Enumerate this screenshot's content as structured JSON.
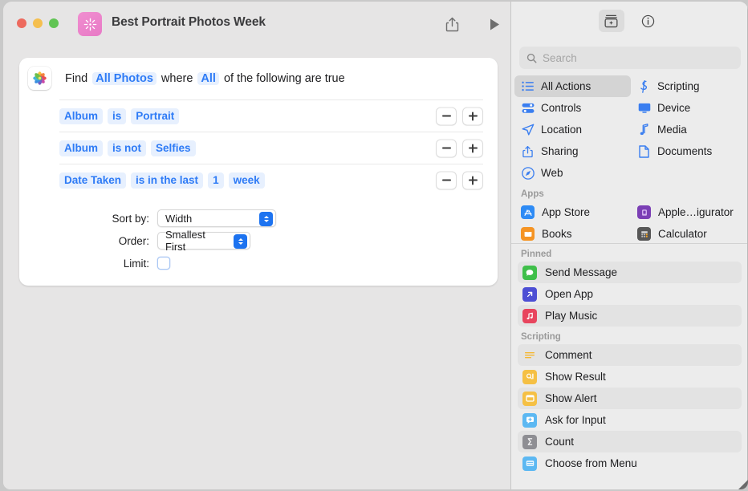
{
  "window": {
    "title": "Best Portrait Photos Week",
    "app_icon": "shortcuts-icon",
    "traffic_lights": [
      "close",
      "minimize",
      "zoom"
    ],
    "share_button": "share-icon",
    "run_button": "play-icon",
    "accent_color": "#2e7bf6",
    "background_color": "#e6e5e5"
  },
  "action_card": {
    "source_icon": "photos-icon",
    "header": {
      "find_label": "Find",
      "source_token": "All Photos",
      "where_label": "where",
      "match_token": "All",
      "suffix_label": "of the following are true"
    },
    "filters": [
      {
        "field": "Album",
        "operator": "is",
        "value": "Portrait",
        "extra": "",
        "unit": "",
        "remove_label": "−",
        "add_label": "+"
      },
      {
        "field": "Album",
        "operator": "is not",
        "value": "Selfies",
        "extra": "",
        "unit": "",
        "remove_label": "−",
        "add_label": "+"
      },
      {
        "field": "Date Taken",
        "operator": "is in the last",
        "value": "1",
        "extra": "week",
        "unit": "",
        "remove_label": "−",
        "add_label": "+"
      }
    ],
    "options": {
      "sort_by_label": "Sort by:",
      "sort_by_value": "Width",
      "order_label": "Order:",
      "order_value": "Smallest First",
      "limit_label": "Limit:",
      "limit_checked": false
    }
  },
  "library": {
    "toolbar": [
      {
        "name": "action-library-button",
        "icon": "library-icon",
        "selected": true
      },
      {
        "name": "info-button",
        "icon": "info-circle-icon",
        "selected": false
      }
    ],
    "search": {
      "placeholder": "Search",
      "value": "",
      "icon": "search-icon"
    },
    "categories": [
      {
        "label": "All Actions",
        "icon": "list-icon",
        "selected": true
      },
      {
        "label": "Scripting",
        "icon": "scripting-icon",
        "selected": false
      },
      {
        "label": "Controls",
        "icon": "controls-icon",
        "selected": false
      },
      {
        "label": "Device",
        "icon": "device-icon",
        "selected": false
      },
      {
        "label": "Location",
        "icon": "location-icon",
        "selected": false
      },
      {
        "label": "Media",
        "icon": "media-note-icon",
        "selected": false
      },
      {
        "label": "Sharing",
        "icon": "share-icon",
        "selected": false
      },
      {
        "label": "Documents",
        "icon": "document-icon",
        "selected": false
      },
      {
        "label": "Web",
        "icon": "web-compass-icon",
        "selected": false
      }
    ],
    "apps_section": {
      "header": "Apps",
      "items": [
        {
          "label": "App Store",
          "icon": "app-store-icon",
          "color": "#2e8bf5"
        },
        {
          "label": "Apple…igurator",
          "icon": "apple-configurator-icon",
          "color": "#7b3fb5"
        },
        {
          "label": "Books",
          "icon": "books-icon",
          "color": "#f59424"
        },
        {
          "label": "Calculator",
          "icon": "calculator-icon",
          "color": "#575757"
        }
      ]
    },
    "pinned_section": {
      "header": "Pinned",
      "items": [
        {
          "label": "Send Message",
          "icon": "message-bubble-icon",
          "color": "#3fbf4a",
          "highlighted": true
        },
        {
          "label": "Open App",
          "icon": "open-app-arrow-icon",
          "color": "#4d4fd4",
          "highlighted": false
        },
        {
          "label": "Play Music",
          "icon": "music-note-icon",
          "color": "#e8455e",
          "highlighted": true
        }
      ]
    },
    "scripting_section": {
      "header": "Scripting",
      "items": [
        {
          "label": "Comment",
          "icon": "comment-lines-icon",
          "color": "#f5b731",
          "highlighted": true
        },
        {
          "label": "Show Result",
          "icon": "show-result-icon",
          "color": "#f5c044",
          "highlighted": false
        },
        {
          "label": "Show Alert",
          "icon": "show-alert-icon",
          "color": "#f5c044",
          "highlighted": true
        },
        {
          "label": "Ask for Input",
          "icon": "ask-input-icon",
          "color": "#5cb8f2",
          "highlighted": false
        },
        {
          "label": "Count",
          "icon": "count-sigma-icon",
          "color": "#8e8e93",
          "highlighted": true
        },
        {
          "label": "Choose from Menu",
          "icon": "choose-menu-icon",
          "color": "#5cb8f2",
          "highlighted": false
        }
      ]
    }
  }
}
